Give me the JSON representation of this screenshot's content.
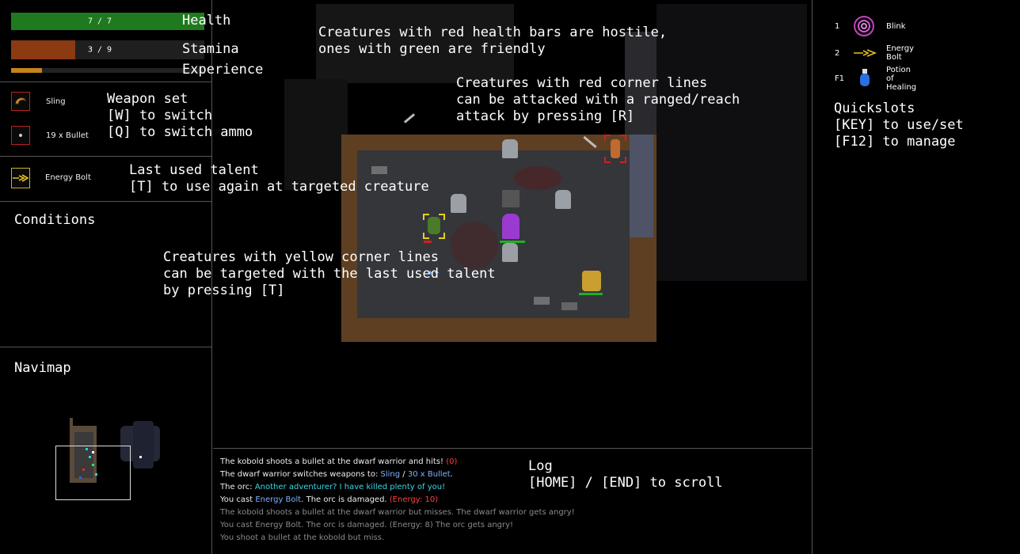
{
  "stats": {
    "health_value": "7 / 7",
    "health_label": "Health",
    "health_fraction": 1.0,
    "stamina_value": "3 / 9",
    "stamina_label": "Stamina",
    "stamina_fraction": 0.333,
    "experience_label": "Experience",
    "experience_fraction": 0.16
  },
  "weapon": {
    "name": "Sling",
    "ammo": "19 x Bullet",
    "hint": "Weapon set\n[W] to switch\n[Q] to switch ammo"
  },
  "talent": {
    "name": "Energy Bolt",
    "hint": "Last used talent\n[T] to use again at targeted creature"
  },
  "conditions": {
    "title": "Conditions"
  },
  "navimap": {
    "title": "Navimap"
  },
  "quickslots": {
    "items": [
      {
        "key": "1",
        "name": "Blink",
        "icon": "blink-spiral-icon"
      },
      {
        "key": "2",
        "name": "Energy Bolt",
        "icon": "energy-bolt-icon"
      },
      {
        "key": "F1",
        "name": "Potion of Healing",
        "icon": "healing-potion-icon"
      }
    ],
    "hint": "Quickslots\n[KEY] to use/set\n[F12] to manage"
  },
  "tips": {
    "health_bars": "Creatures with red health bars are hostile,\nones with green are friendly",
    "red_corners": "Creatures with red corner lines\ncan be attacked with a ranged/reach\nattack by pressing [R]",
    "yellow_corners": "Creatures with yellow corner lines\ncan be targeted with the last used talent\nby pressing [T]"
  },
  "log": {
    "hint": "Log\n[HOME] / [END] to scroll",
    "line1_a": "The kobold shoots a bullet at the dwarf warrior and hits! ",
    "line1_b": "(0)",
    "line2_a": "The dwarf warrior switches weapons to: ",
    "line2_b": "Sling",
    "line2_c": " / ",
    "line2_d": "30 x Bullet",
    "line2_e": ".",
    "line3_a": "The orc: ",
    "line3_b": "Another adventurer? I have killed plenty of you!",
    "line4_a": "You cast ",
    "line4_b": "Energy Bolt",
    "line4_c": ". The orc is damaged. ",
    "line4_d": "(Energy: 10)",
    "line5": "The kobold shoots a bullet at the dwarf warrior but misses. The dwarf warrior gets angry!",
    "line6": "You cast Energy Bolt. The orc is damaged. (Energy: 8) The orc gets angry!",
    "line7": "You shoot a bullet at the kobold but miss."
  },
  "colors": {
    "health": "#1f7a1f",
    "stamina": "#8b3a12",
    "experience": "#c4841a",
    "log_red": "#ff4040",
    "log_blue": "#7fb0ff",
    "log_cyan": "#3cd6e6",
    "log_dim": "#8a8a8a"
  }
}
